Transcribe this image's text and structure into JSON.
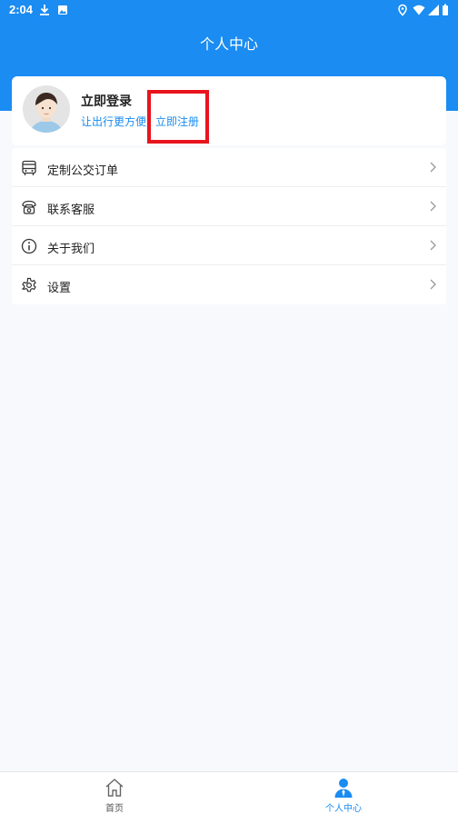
{
  "status_bar": {
    "time": "2:04"
  },
  "header": {
    "title": "个人中心"
  },
  "profile": {
    "title": "立即登录",
    "subtitle": "让出行更方便",
    "register": "立即注册"
  },
  "menu": {
    "items": [
      {
        "label": "定制公交订单",
        "icon": "bus-icon"
      },
      {
        "label": "联系客服",
        "icon": "phone-icon"
      },
      {
        "label": "关于我们",
        "icon": "info-icon"
      },
      {
        "label": "设置",
        "icon": "gear-icon"
      }
    ]
  },
  "tabbar": {
    "tabs": [
      {
        "label": "首页",
        "active": false
      },
      {
        "label": "个人中心",
        "active": true
      }
    ]
  },
  "colors": {
    "brand": "#1a8cf2",
    "highlight": "#e8141e"
  }
}
